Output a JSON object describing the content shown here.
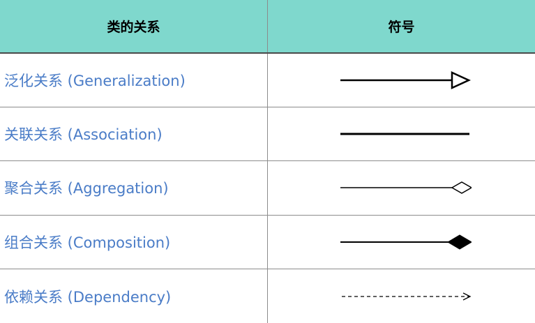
{
  "header": {
    "relation_col": "类的关系",
    "symbol_col": "符号"
  },
  "rows": [
    {
      "label": "泛化关系 (Generalization)",
      "symbol": "line-hollow-triangle-arrow-icon"
    },
    {
      "label": "关联关系 (Association)",
      "symbol": "solid-line-icon"
    },
    {
      "label": "聚合关系 (Aggregation)",
      "symbol": "line-hollow-diamond-icon"
    },
    {
      "label": "组合关系 (Composition)",
      "symbol": "line-filled-diamond-icon"
    },
    {
      "label": "依赖关系 (Dependency)",
      "symbol": "dashed-line-open-arrow-icon"
    }
  ],
  "colors": {
    "header_bg": "#7fd8cd",
    "label_text": "#4a7cc7",
    "grid_line": "#8c8c8c"
  }
}
